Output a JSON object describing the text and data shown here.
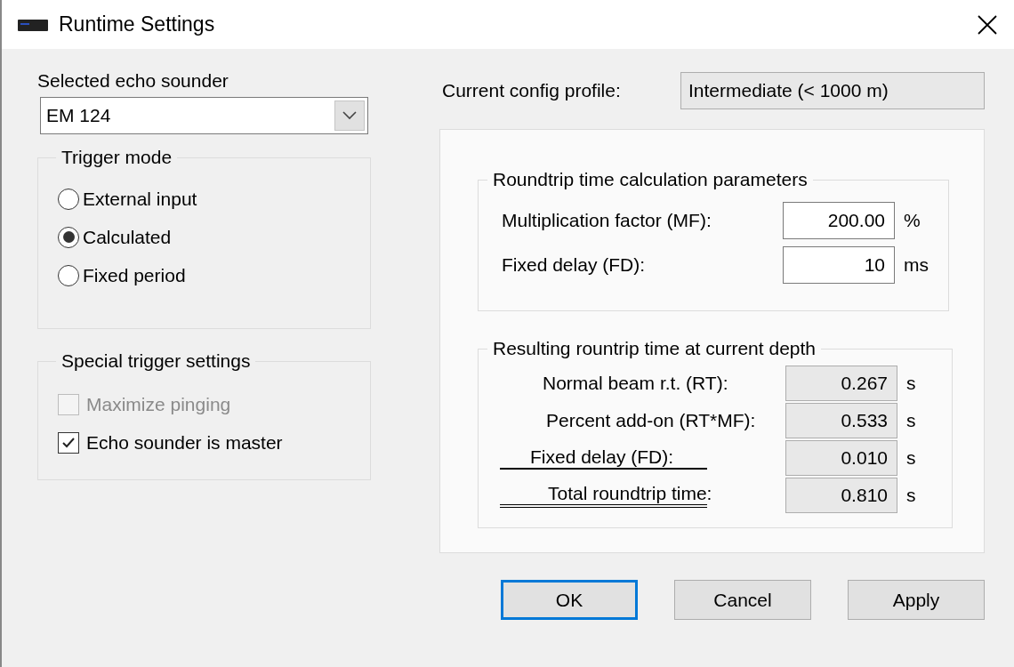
{
  "window": {
    "title": "Runtime Settings"
  },
  "echo_sounder": {
    "label": "Selected echo sounder",
    "value": "EM 124"
  },
  "trigger_mode": {
    "title": "Trigger mode",
    "options": [
      {
        "label": "External input",
        "selected": false
      },
      {
        "label": "Calculated",
        "selected": true
      },
      {
        "label": "Fixed period",
        "selected": false
      }
    ]
  },
  "special_trigger": {
    "title": "Special trigger settings",
    "options": [
      {
        "label": "Maximize pinging",
        "checked": false,
        "disabled": true
      },
      {
        "label": "Echo sounder is master",
        "checked": true,
        "disabled": false
      }
    ]
  },
  "config_profile": {
    "label": "Current config profile:",
    "value": "Intermediate (< 1000 m)"
  },
  "calc_params": {
    "title": "Roundtrip time calculation parameters",
    "rows": [
      {
        "label": "Multiplication factor (MF):",
        "value": "200.00",
        "unit": "%"
      },
      {
        "label": "Fixed delay (FD):",
        "value": "10",
        "unit": "ms"
      }
    ]
  },
  "result": {
    "title": "Resulting rountrip time at current depth",
    "rows": [
      {
        "kind": "term",
        "label": "Normal beam r.t. (RT):",
        "value": "0.267",
        "unit": "s"
      },
      {
        "kind": "term",
        "label": "Percent add-on (RT*MF):",
        "value": "0.533",
        "unit": "s"
      },
      {
        "kind": "last_term",
        "label": "Fixed delay (FD):",
        "value": "0.010",
        "unit": "s"
      },
      {
        "kind": "total",
        "label": "Total roundtrip time:",
        "value": "0.810",
        "unit": "s"
      }
    ]
  },
  "buttons": [
    {
      "label": "OK",
      "default": true
    },
    {
      "label": "Cancel",
      "default": false
    },
    {
      "label": "Apply",
      "default": false
    }
  ]
}
